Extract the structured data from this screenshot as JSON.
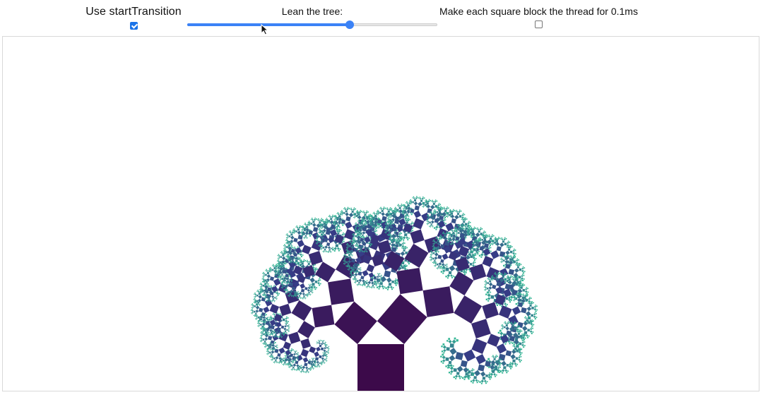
{
  "controls": {
    "transition": {
      "label": "Use startTransition",
      "checked": true
    },
    "lean": {
      "label": "Lean the tree:",
      "value": 0.65
    },
    "block": {
      "label": "Make each square block the thread for 0.1ms",
      "checked": false
    }
  },
  "tree": {
    "depth": 11,
    "lean": 0.65,
    "color_root": "#3c0a4a",
    "color_leaf": "#35b795"
  }
}
